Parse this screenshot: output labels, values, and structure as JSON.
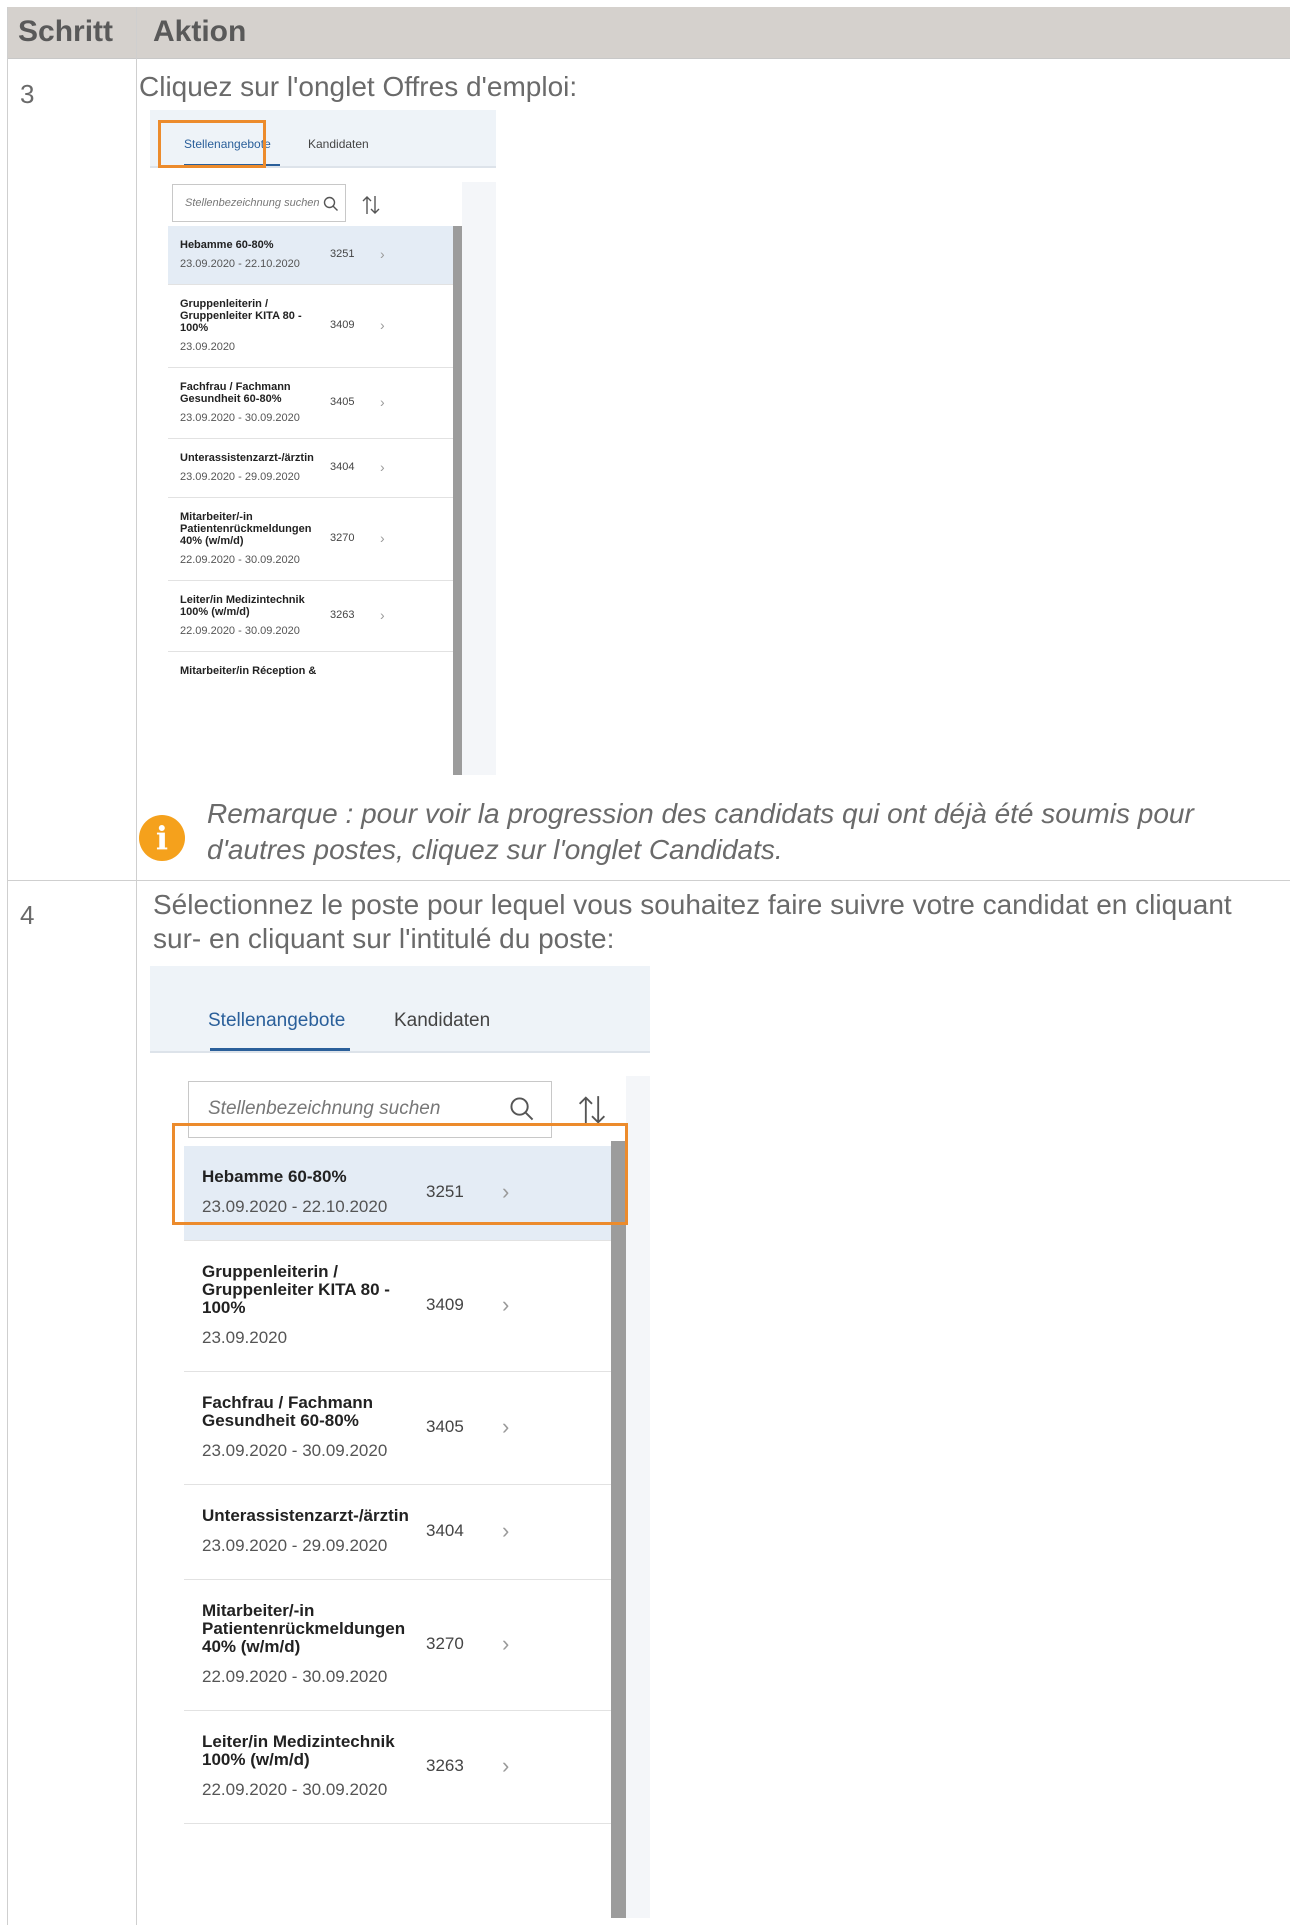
{
  "table": {
    "header": {
      "col1": "Schritt",
      "col2": "Aktion"
    },
    "step3": {
      "number": "3",
      "instruction": "Cliquez sur l'onglet Offres d'emploi:",
      "note_line1": "Remarque : pour voir la progression des candidats qui ont déjà été soumis pour",
      "note_line2": "d'autres postes, cliquez sur l'onglet Candidats."
    },
    "step4": {
      "number": "4",
      "instruction_line1": "Sélectionnez le poste pour lequel vous souhaitez faire suivre votre candidat en cliquant",
      "instruction_line2": "sur- en cliquant sur l'intitulé du poste:"
    }
  },
  "app": {
    "tabs": [
      "Stellenangebote",
      "Kandidaten"
    ],
    "search_placeholder": "Stellenbezeichnung suchen",
    "jobs": [
      {
        "title_lines": [
          "Hebamme 60-80%"
        ],
        "dates": "23.09.2020 - 22.10.2020",
        "id": "3251"
      },
      {
        "title_lines": [
          "Gruppenleiterin /",
          "Gruppenleiter KITA 80 -",
          "100%"
        ],
        "dates": "23.09.2020",
        "id": "3409"
      },
      {
        "title_lines": [
          "Fachfrau / Fachmann",
          "Gesundheit 60-80%"
        ],
        "dates": "23.09.2020 - 30.09.2020",
        "id": "3405"
      },
      {
        "title_lines": [
          "Unterassistenzarzt-/ärztin"
        ],
        "dates": "23.09.2020 - 29.09.2020",
        "id": "3404"
      },
      {
        "title_lines": [
          "Mitarbeiter/-in",
          "Patientenrückmeldungen",
          "40% (w/m/d)"
        ],
        "dates": "22.09.2020 - 30.09.2020",
        "id": "3270"
      },
      {
        "title_lines": [
          "Leiter/in Medizintechnik",
          "100% (w/m/d)"
        ],
        "dates": "22.09.2020 - 30.09.2020",
        "id": "3263"
      }
    ],
    "partial_item": "Mitarbeiter/in Réception &"
  },
  "colors": {
    "highlight": "#ec8b2c",
    "tab_active": "#2a5f9a",
    "info_icon": "#f5a11c",
    "header_bg": "#d5d1cd"
  },
  "icons": [
    "search-icon",
    "sort-icon",
    "chevron-right-icon",
    "info-icon"
  ]
}
